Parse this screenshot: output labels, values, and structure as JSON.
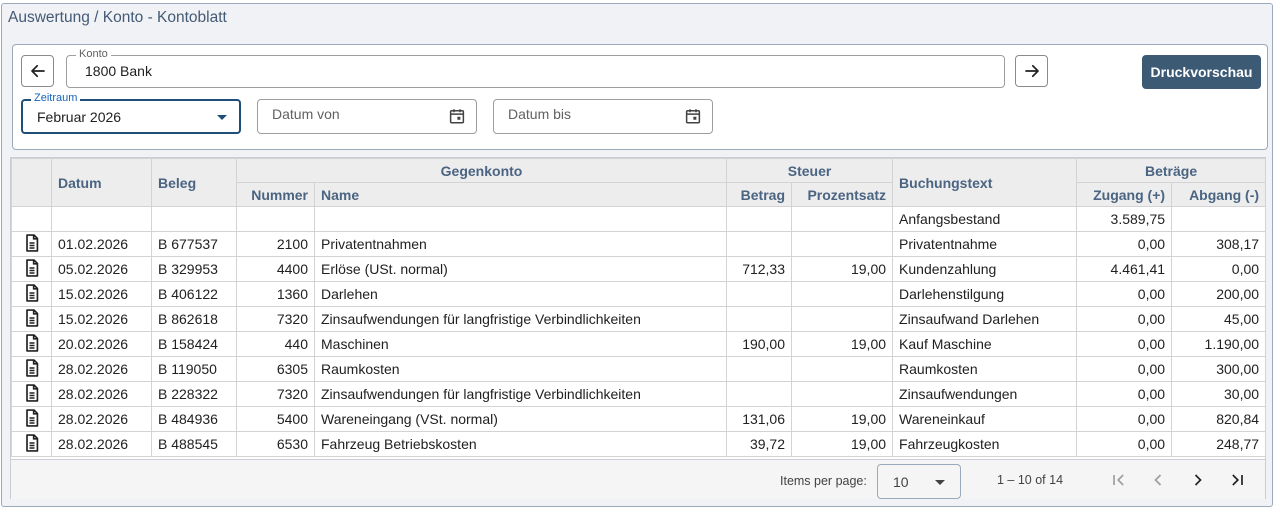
{
  "window": {
    "title": "Auswertung / Konto - Kontoblatt"
  },
  "konto": {
    "label": "Konto",
    "value": "1800 Bank"
  },
  "zeitraum": {
    "label": "Zeitraum",
    "value": "Februar 2026"
  },
  "datum_von": {
    "placeholder": "Datum von"
  },
  "datum_bis": {
    "placeholder": "Datum bis"
  },
  "toolbar": {
    "print_label": "Druckvorschau"
  },
  "table": {
    "group_headers": {
      "gegenkonto": "Gegenkonto",
      "steuer": "Steuer",
      "betraege": "Beträge"
    },
    "headers": {
      "datum": "Datum",
      "beleg": "Beleg",
      "nummer": "Nummer",
      "name": "Name",
      "betrag": "Betrag",
      "prozentsatz": "Prozentsatz",
      "buchungstext": "Buchungstext",
      "zugang": "Zugang (+)",
      "abgang": "Abgang (-)"
    },
    "rows": [
      {
        "icon": false,
        "datum": "",
        "beleg": "",
        "nummer": "",
        "name": "",
        "betrag": "",
        "prozentsatz": "",
        "buchungstext": "Anfangsbestand",
        "zugang": "3.589,75",
        "abgang": ""
      },
      {
        "icon": true,
        "datum": "01.02.2026",
        "beleg": "B 677537",
        "nummer": "2100",
        "name": "Privatentnahmen",
        "betrag": "",
        "prozentsatz": "",
        "buchungstext": "Privatentnahme",
        "zugang": "0,00",
        "abgang": "308,17"
      },
      {
        "icon": true,
        "datum": "05.02.2026",
        "beleg": "B 329953",
        "nummer": "4400",
        "name": "Erlöse (USt. normal)",
        "betrag": "712,33",
        "prozentsatz": "19,00",
        "buchungstext": "Kundenzahlung",
        "zugang": "4.461,41",
        "abgang": "0,00"
      },
      {
        "icon": true,
        "datum": "15.02.2026",
        "beleg": "B 406122",
        "nummer": "1360",
        "name": "Darlehen",
        "betrag": "",
        "prozentsatz": "",
        "buchungstext": "Darlehenstilgung",
        "zugang": "0,00",
        "abgang": "200,00"
      },
      {
        "icon": true,
        "datum": "15.02.2026",
        "beleg": "B 862618",
        "nummer": "7320",
        "name": "Zinsaufwendungen für langfristige Verbindlichkeiten",
        "betrag": "",
        "prozentsatz": "",
        "buchungstext": "Zinsaufwand Darlehen",
        "zugang": "0,00",
        "abgang": "45,00"
      },
      {
        "icon": true,
        "datum": "20.02.2026",
        "beleg": "B 158424",
        "nummer": "440",
        "name": "Maschinen",
        "betrag": "190,00",
        "prozentsatz": "19,00",
        "buchungstext": "Kauf Maschine",
        "zugang": "0,00",
        "abgang": "1.190,00"
      },
      {
        "icon": true,
        "datum": "28.02.2026",
        "beleg": "B 119050",
        "nummer": "6305",
        "name": "Raumkosten",
        "betrag": "",
        "prozentsatz": "",
        "buchungstext": "Raumkosten",
        "zugang": "0,00",
        "abgang": "300,00"
      },
      {
        "icon": true,
        "datum": "28.02.2026",
        "beleg": "B 228322",
        "nummer": "7320",
        "name": "Zinsaufwendungen für langfristige Verbindlichkeiten",
        "betrag": "",
        "prozentsatz": "",
        "buchungstext": "Zinsaufwendungen",
        "zugang": "0,00",
        "abgang": "30,00"
      },
      {
        "icon": true,
        "datum": "28.02.2026",
        "beleg": "B 484936",
        "nummer": "5400",
        "name": "Wareneingang (VSt. normal)",
        "betrag": "131,06",
        "prozentsatz": "19,00",
        "buchungstext": "Wareneinkauf",
        "zugang": "0,00",
        "abgang": "820,84"
      },
      {
        "icon": true,
        "datum": "28.02.2026",
        "beleg": "B 488545",
        "nummer": "6530",
        "name": "Fahrzeug Betriebskosten",
        "betrag": "39,72",
        "prozentsatz": "19,00",
        "buchungstext": "Fahrzeugkosten",
        "zugang": "0,00",
        "abgang": "248,77"
      }
    ]
  },
  "paginator": {
    "items_per_page_label": "Items per page:",
    "items_per_page_value": "10",
    "range_label": "1 – 10 of 14"
  },
  "colors": {
    "accent": "#3d5a75",
    "header_text": "#4a6482",
    "border": "#9aa9bb"
  }
}
